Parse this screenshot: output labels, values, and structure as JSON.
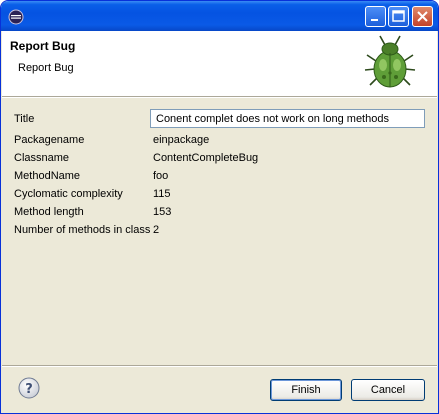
{
  "header": {
    "title": "Report Bug",
    "subtitle": "Report Bug"
  },
  "fields": [
    {
      "label": "Title",
      "value": "Conent complet does not work on long methods",
      "editable": true
    },
    {
      "label": "Packagename",
      "value": "einpackage"
    },
    {
      "label": "Classname",
      "value": "ContentCompleteBug"
    },
    {
      "label": "MethodName",
      "value": "foo"
    },
    {
      "label": "Cyclomatic complexity",
      "value": "115"
    },
    {
      "label": "Method length",
      "value": "153"
    },
    {
      "label": "Number of methods in class",
      "value": "2"
    }
  ],
  "buttons": {
    "finish": "Finish",
    "cancel": "Cancel"
  },
  "icons": {
    "app": "eclipse-icon",
    "header": "bug-icon",
    "help": "help-icon"
  },
  "colors": {
    "titlebar": "#0553e2",
    "dialog_bg": "#ece9d8",
    "close": "#c4422a"
  }
}
